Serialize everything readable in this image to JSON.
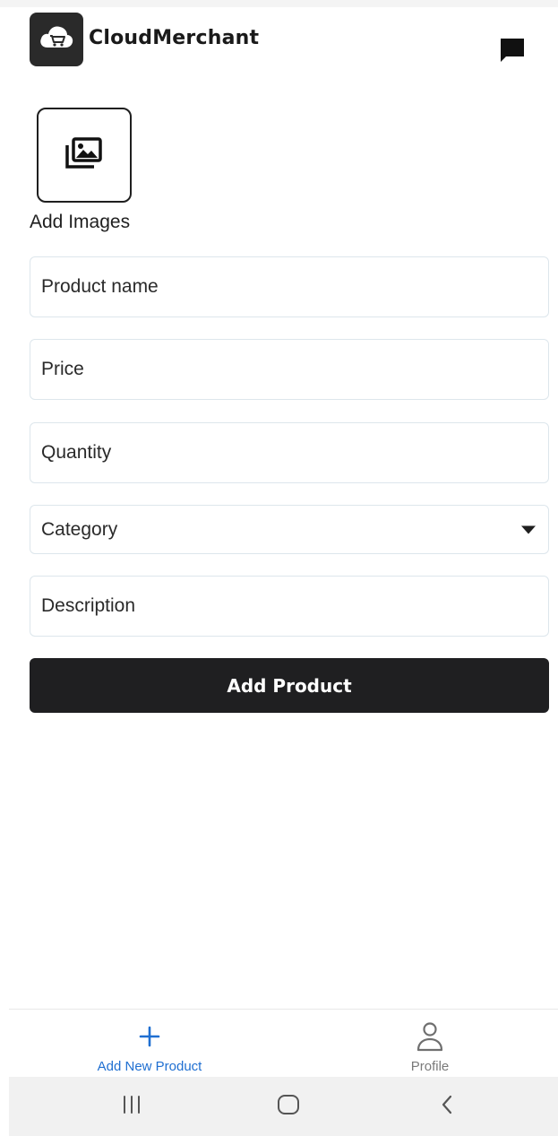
{
  "app": {
    "title": "CloudMerchant",
    "logo_icon": "cloud-cart-icon",
    "accent_color": "#1f6fd1",
    "button_color": "#1f1f21"
  },
  "header": {
    "chat_icon": "chat-icon"
  },
  "images": {
    "icon": "image-gallery-icon",
    "label": "Add Images"
  },
  "form": {
    "product_name": {
      "placeholder": "Product name",
      "value": ""
    },
    "price": {
      "placeholder": "Price",
      "value": ""
    },
    "quantity": {
      "placeholder": "Quantity",
      "value": ""
    },
    "category": {
      "placeholder": "Category",
      "selected": ""
    },
    "description": {
      "placeholder": "Description",
      "value": ""
    },
    "submit_label": "Add Product"
  },
  "bottom_nav": {
    "items": [
      {
        "label": "Add New Product",
        "icon": "plus-icon",
        "active": true
      },
      {
        "label": "Profile",
        "icon": "person-icon",
        "active": false
      }
    ]
  },
  "system_nav": {
    "recents_icon": "recents-icon",
    "home_icon": "home-icon",
    "back_icon": "back-icon"
  }
}
